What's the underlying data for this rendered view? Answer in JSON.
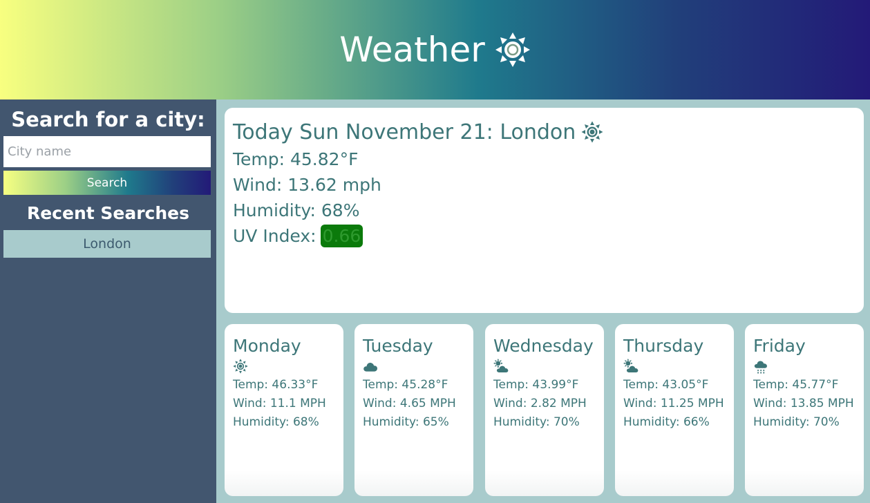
{
  "header": {
    "title": "Weather",
    "icon": "sun-icon",
    "gradient": [
      "#f8ff80",
      "#1f7a8c",
      "#231a78"
    ]
  },
  "sidebar": {
    "heading": "Search for a city:",
    "search_placeholder": "City name",
    "search_value": "",
    "search_button": "Search",
    "recent_heading": "Recent Searches",
    "recent": [
      "London"
    ]
  },
  "today": {
    "title": "Today Sun November 21: London",
    "icon": "sun-icon",
    "temp": "Temp: 45.82°F",
    "wind": "Wind: 13.62 mph",
    "humidity": "Humidity: 68%",
    "uv_label": "UV Index:",
    "uv_value": "0.66",
    "uv_color": "#0b7a0b"
  },
  "forecast": [
    {
      "day": "Monday",
      "icon": "sun-icon",
      "temp": "Temp: 46.33°F",
      "wind": "Wind: 11.1 MPH",
      "humidity": "Humidity: 68%"
    },
    {
      "day": "Tuesday",
      "icon": "cloud-icon",
      "temp": "Temp: 45.28°F",
      "wind": "Wind: 4.65 MPH",
      "humidity": "Humidity: 65%"
    },
    {
      "day": "Wednesday",
      "icon": "partly-cloudy-icon",
      "temp": "Temp: 43.99°F",
      "wind": "Wind: 2.82 MPH",
      "humidity": "Humidity: 70%"
    },
    {
      "day": "Thursday",
      "icon": "partly-cloudy-icon",
      "temp": "Temp: 43.05°F",
      "wind": "Wind: 11.25 MPH",
      "humidity": "Humidity: 66%"
    },
    {
      "day": "Friday",
      "icon": "rain-icon",
      "temp": "Temp: 45.77°F",
      "wind": "Wind: 13.85 MPH",
      "humidity": "Humidity: 70%"
    }
  ]
}
